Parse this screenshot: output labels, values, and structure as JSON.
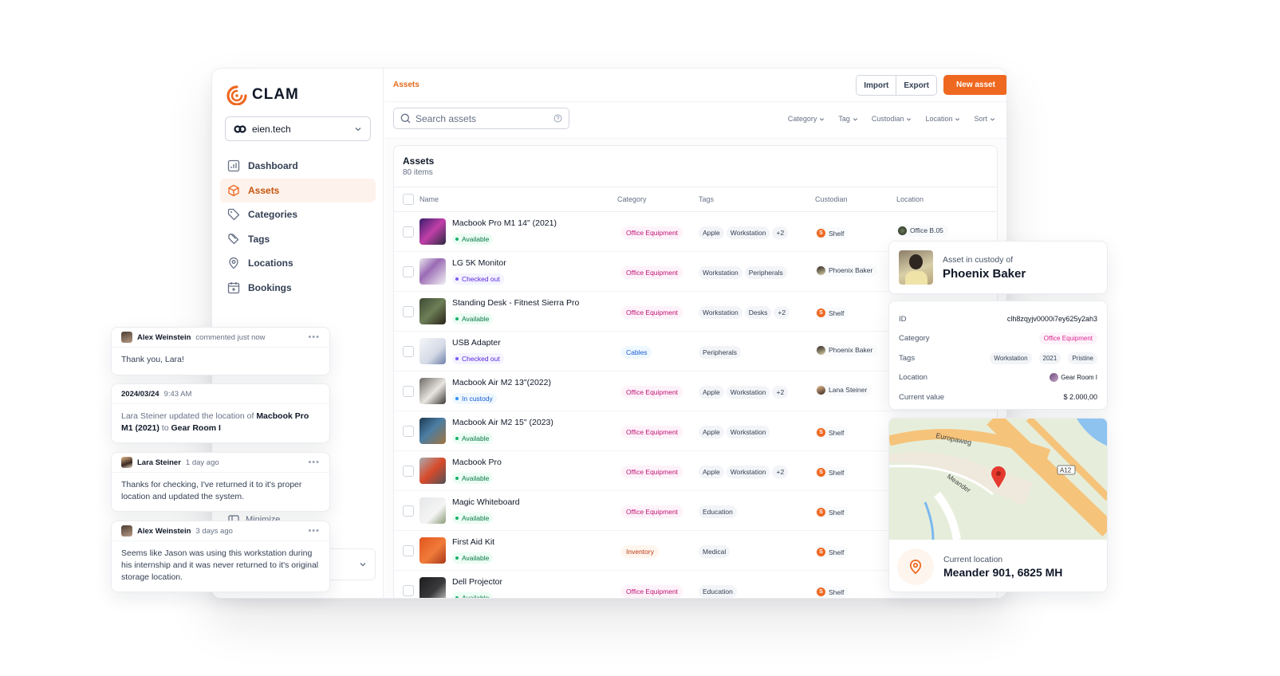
{
  "brand": {
    "name": "CLAM",
    "accent": "#ef6820"
  },
  "org_switcher": {
    "name": "eien.tech"
  },
  "sidebar": {
    "items": [
      {
        "label": "Dashboard",
        "icon": "chart-icon"
      },
      {
        "label": "Assets",
        "icon": "cube-icon",
        "active": true
      },
      {
        "label": "Categories",
        "icon": "tag-icon"
      },
      {
        "label": "Tags",
        "icon": "tags-icon"
      },
      {
        "label": "Locations",
        "icon": "map-pin-icon"
      },
      {
        "label": "Bookings",
        "icon": "calendar-plus-icon"
      }
    ],
    "minimize_label": "Minimize"
  },
  "topbar": {
    "breadcrumb": "Assets",
    "import_label": "Import",
    "export_label": "Export",
    "new_asset_label": "New asset"
  },
  "search": {
    "placeholder": "Search assets",
    "value": ""
  },
  "filters": [
    "Category",
    "Tag",
    "Custodian",
    "Location",
    "Sort"
  ],
  "table": {
    "title": "Assets",
    "count": "80 items",
    "columns": [
      "Name",
      "Category",
      "Tags",
      "Custodian",
      "Location"
    ],
    "rows": [
      {
        "name": "Macbook Pro M1 14\" (2021)",
        "status": "Available",
        "category": "Office Equipment",
        "tags": [
          "Apple",
          "Workstation",
          "+2"
        ],
        "custodian": "Shelf",
        "location": "Office B.05"
      },
      {
        "name": "LG 5K Monitor",
        "status": "Checked out",
        "category": "Office Equipment",
        "tags": [
          "Workstation",
          "Peripherals"
        ],
        "custodian": "Phoenix Baker",
        "location": ""
      },
      {
        "name": "Standing Desk - Fitnest Sierra Pro",
        "status": "Available",
        "category": "Office Equipment",
        "tags": [
          "Workstation",
          "Desks",
          "+2"
        ],
        "custodian": "Shelf",
        "location": ""
      },
      {
        "name": "USB Adapter",
        "status": "Checked out",
        "category": "Cables",
        "tags": [
          "Peripherals"
        ],
        "custodian": "Phoenix Baker",
        "location": ""
      },
      {
        "name": "Macbook Air M2 13\"(2022)",
        "status": "In custody",
        "category": "Office Equipment",
        "tags": [
          "Apple",
          "Workstation",
          "+2"
        ],
        "custodian": "Lana Steiner",
        "location": ""
      },
      {
        "name": "Macbook Air M2 15\" (2023)",
        "status": "Available",
        "category": "Office Equipment",
        "tags": [
          "Apple",
          "Workstation"
        ],
        "custodian": "Shelf",
        "location": ""
      },
      {
        "name": "Macbook Pro",
        "status": "Available",
        "category": "Office Equipment",
        "tags": [
          "Apple",
          "Workstation",
          "+2"
        ],
        "custodian": "Shelf",
        "location": ""
      },
      {
        "name": "Magic Whiteboard",
        "status": "Available",
        "category": "Office Equipment",
        "tags": [
          "Education"
        ],
        "custodian": "Shelf",
        "location": ""
      },
      {
        "name": "First Aid Kit",
        "status": "Available",
        "category": "Inventory",
        "tags": [
          "Medical"
        ],
        "custodian": "Shelf",
        "location": ""
      },
      {
        "name": "Dell Projector",
        "status": "Available",
        "category": "Office Equipment",
        "tags": [
          "Education"
        ],
        "custodian": "Shelf",
        "location": ""
      }
    ]
  },
  "custody_card": {
    "label": "Asset in custody of",
    "name": "Phoenix Baker"
  },
  "details_card": {
    "rows": [
      {
        "label": "ID",
        "value": "clh8zqyjv0000i7ey625y2ah3"
      },
      {
        "label": "Category",
        "value": "Office Equipment"
      },
      {
        "label": "Tags",
        "values": [
          "Workstation",
          "2021",
          "Pristine"
        ]
      },
      {
        "label": "Location",
        "value": "Gear Room I"
      },
      {
        "label": "Current value",
        "value": "$ 2.000,00"
      }
    ]
  },
  "map_card": {
    "street_labels": [
      "Europaweg",
      "Meander",
      "A12"
    ],
    "location_label": "Current location",
    "address": "Meander 901, 6825 MH"
  },
  "comments": [
    {
      "author": "Alex Weinstein",
      "meta": "commented just now",
      "text": "Thank you, Lara!"
    },
    {
      "date": "2024/03/24",
      "time": "9:43 AM",
      "actor": "Lara Steiner",
      "action": "updated the location of",
      "asset": "Macbook Pro M1 (2021)",
      "to": "to",
      "target": "Gear Room I"
    },
    {
      "author": "Lara Steiner",
      "meta": "1 day ago",
      "text": "Thanks for checking, I've returned it to it's proper location and updated the system."
    },
    {
      "author": "Alex Weinstein",
      "meta": "3 days ago",
      "text": "Seems like Jason was using this workstation during his internship and it was never returned to it's original storage location."
    }
  ]
}
